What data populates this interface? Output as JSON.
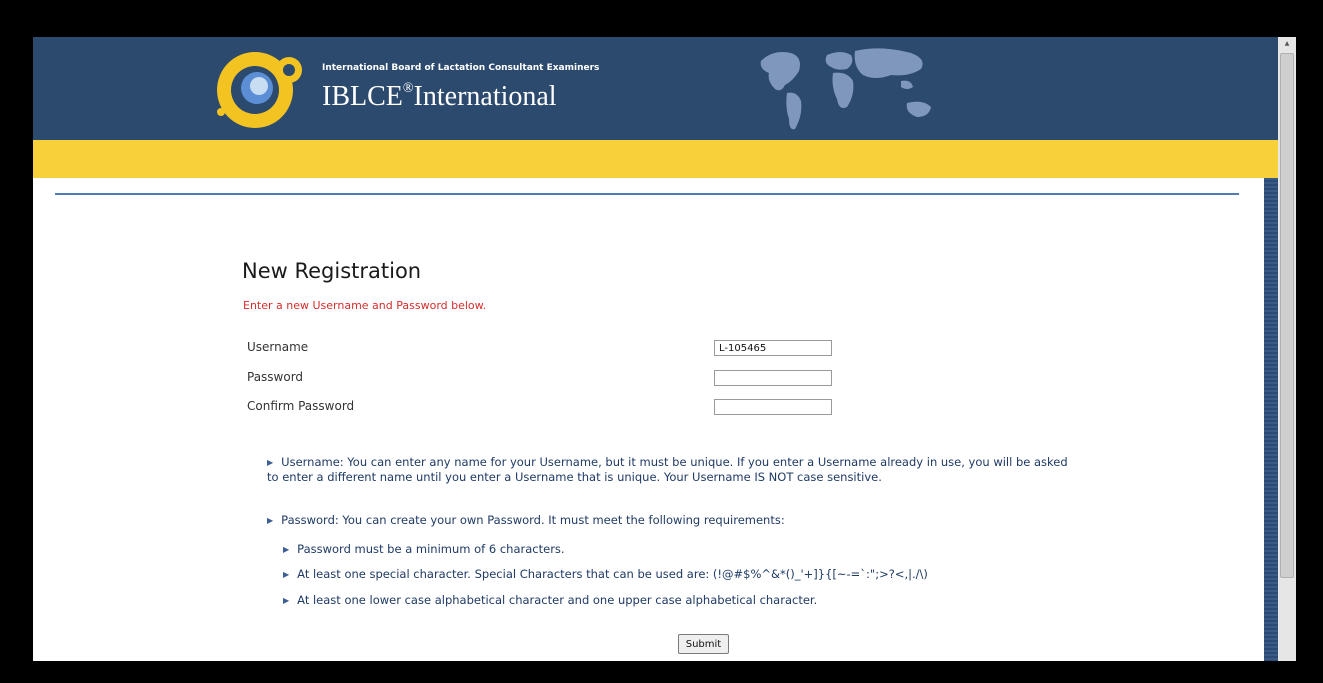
{
  "header": {
    "org_name": "International Board of Lactation Consultant Examiners",
    "brand_name": "IBLCE",
    "brand_mark": "®",
    "brand_suffix": "International"
  },
  "form": {
    "title": "New Registration",
    "instruction": "Enter a new Username and Password below.",
    "username_label": "Username",
    "username_value": "L-105465",
    "password_label": "Password",
    "confirm_label": "Confirm Password",
    "submit_label": "Submit"
  },
  "info": {
    "username_line1": "Username: You can enter any name for your Username, but it must be unique. If you enter a Username already in use, you will be asked",
    "username_line2": "to enter a different name until you enter a Username that is unique. Your Username IS NOT case sensitive.",
    "password_intro": "Password: You can create your own Password. It must meet the following requirements:",
    "requirements": [
      "Password must be a minimum of 6 characters.",
      "At least one special character. Special Characters that can be used are: (!@#$%^&*()_'+]}{[~-=`:\";>?<,|./\\)",
      "At least one lower case alphabetical character and one upper case alphabetical character."
    ]
  },
  "icons": {
    "bullet": "triangle-right-icon",
    "logo": "iblce-logo",
    "map": "world-map"
  },
  "colors": {
    "header_bg": "#2c4a6e",
    "band": "#f8d13a",
    "error_text": "#d62c2c",
    "info_text": "#1f3a66"
  }
}
